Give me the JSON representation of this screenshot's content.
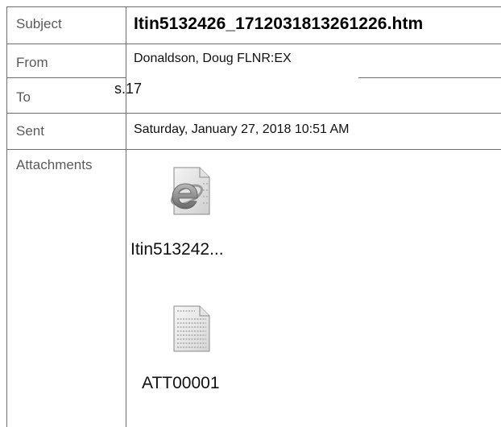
{
  "header": {
    "subject": {
      "label": "Subject",
      "value": "Itin5132426_1712031813261226.htm"
    },
    "from": {
      "label": "From",
      "value": "Donaldson, Doug FLNR:EX"
    },
    "to": {
      "label": "To",
      "value": "s.17"
    },
    "sent": {
      "label": "Sent",
      "value": "Saturday, January 27, 2018 10:51 AM"
    },
    "attachments": {
      "label": "Attachments",
      "items": [
        {
          "name": "Itin513242...",
          "icon": "internet-explorer-file-icon"
        },
        {
          "name": "ATT00001",
          "icon": "text-document-icon"
        }
      ]
    }
  }
}
